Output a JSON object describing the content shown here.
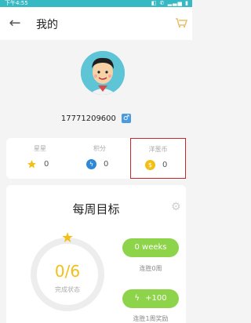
{
  "status_bar": {
    "time": "下午4:55"
  },
  "header": {
    "title": "我的"
  },
  "profile": {
    "phone": "17771209600",
    "gender_symbol": "♂"
  },
  "stats": [
    {
      "label": "星星",
      "value": "0",
      "icon": "star-icon",
      "color": "#f2bf16"
    },
    {
      "label": "积分",
      "value": "0",
      "icon": "lightning-icon",
      "color": "#2f88d6"
    },
    {
      "label": "洋葱币",
      "value": "0",
      "icon": "dollar-coin-icon",
      "color": "#f2bf16"
    }
  ],
  "weekly": {
    "title": "每周目标",
    "progress_text": "0/6",
    "progress_fraction": 0,
    "progress_label": "完成状态",
    "weeks_badge": "0 weeks",
    "weeks_label": "连胜0周",
    "reward_badge": "+100",
    "reward_label": "连胜1周奖励"
  },
  "colors": {
    "accent": "#35b9c3",
    "gold": "#f2bf16",
    "green": "#8ed44b",
    "highlight": "#c9262c"
  }
}
